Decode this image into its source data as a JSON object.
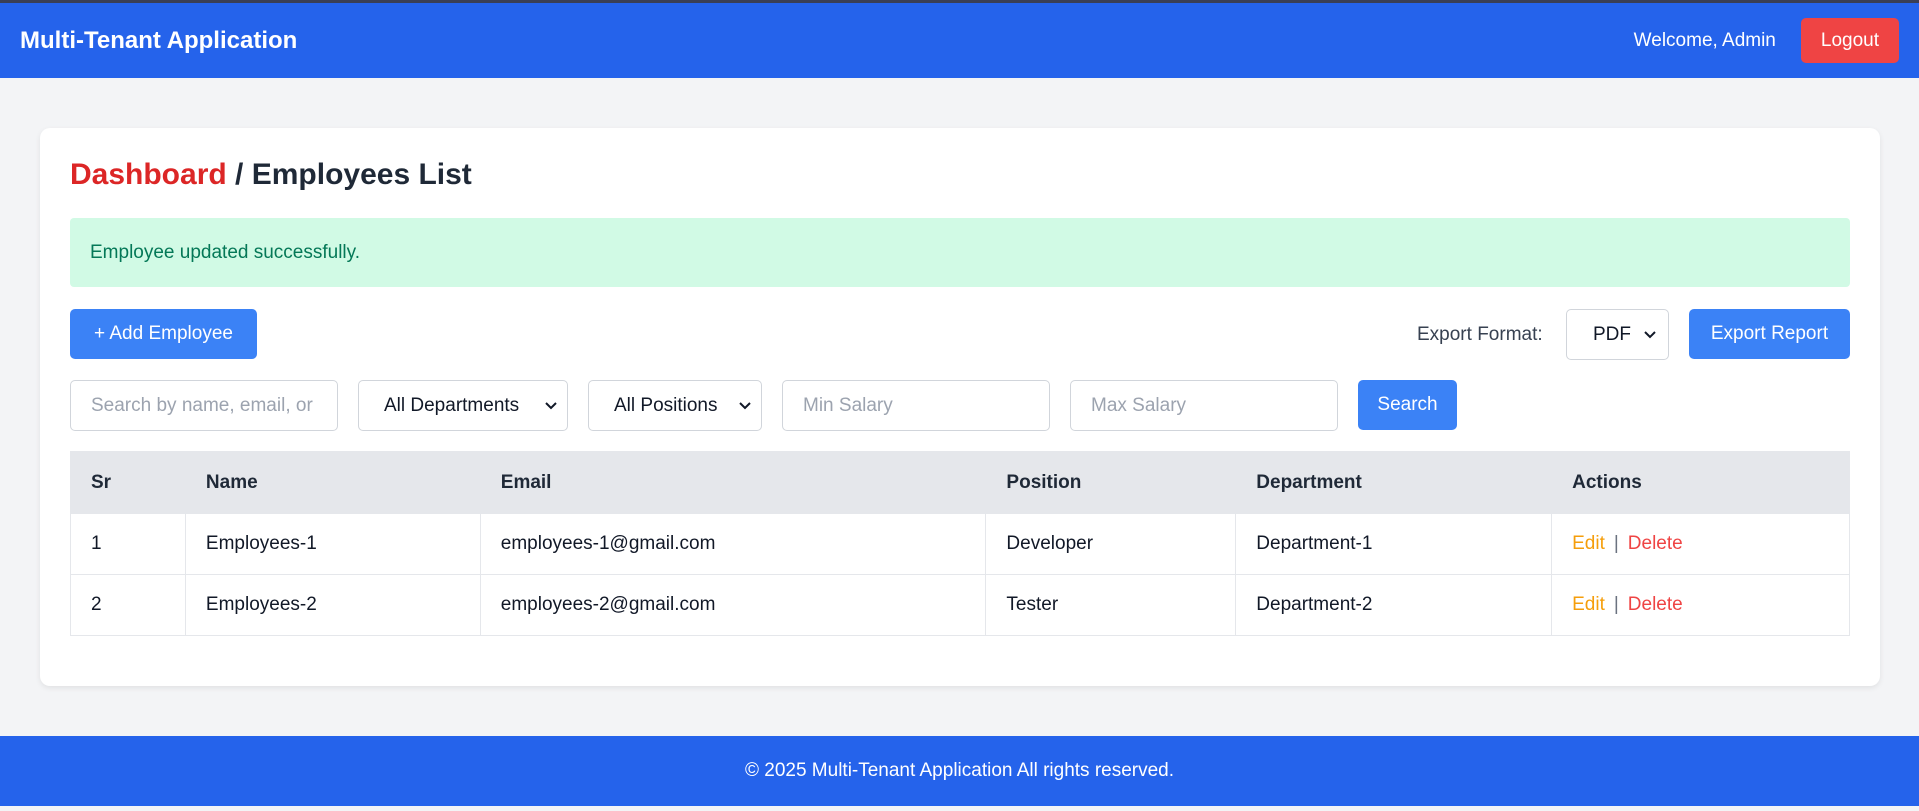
{
  "navbar": {
    "brand": "Multi-Tenant Application",
    "welcome": "Welcome, Admin",
    "logout_label": "Logout"
  },
  "page": {
    "breadcrumb_link": "Dashboard",
    "breadcrumb_separator": " / ",
    "title": "Employees List"
  },
  "alert": {
    "message": "Employee updated successfully."
  },
  "toolbar": {
    "add_label": "+ Add Employee",
    "export_format_label": "Export Format:",
    "export_format_value": "PDF",
    "export_button_label": "Export Report"
  },
  "filters": {
    "search_placeholder": "Search by name, email, or",
    "department_value": "All Departments",
    "position_value": "All Positions",
    "min_salary_placeholder": "Min Salary",
    "max_salary_placeholder": "Max Salary",
    "search_button_label": "Search"
  },
  "table": {
    "headers": [
      "Sr",
      "Name",
      "Email",
      "Position",
      "Department",
      "Actions"
    ],
    "rows": [
      {
        "sr": "1",
        "name": "Employees-1",
        "email": "employees-1@gmail.com",
        "position": "Developer",
        "department": "Department-1",
        "edit": "Edit",
        "sep": "|",
        "delete": "Delete"
      },
      {
        "sr": "2",
        "name": "Employees-2",
        "email": "employees-2@gmail.com",
        "position": "Tester",
        "department": "Department-2",
        "edit": "Edit",
        "sep": "|",
        "delete": "Delete"
      }
    ]
  },
  "footer": {
    "text": "© 2025 Multi-Tenant Application All rights reserved."
  },
  "colors": {
    "primary": "#2563eb",
    "button_blue": "#3b82f6",
    "danger": "#ef4444",
    "warning": "#f59e0b",
    "success_bg": "#d1fae5",
    "success_text": "#047857"
  }
}
